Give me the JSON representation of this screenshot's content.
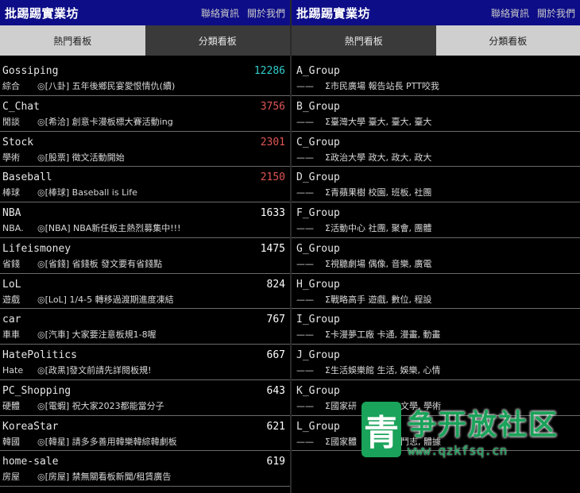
{
  "left": {
    "title": "批踢踢實業坊",
    "links": [
      "聯絡資訊",
      "關於我們"
    ],
    "tabs": [
      {
        "label": "熱門看板"
      },
      {
        "label": "分類看板"
      }
    ],
    "boards": [
      {
        "name": "Gossiping",
        "count": "12286",
        "color": "#33cccc",
        "category": "綜合",
        "desc": "◎[八卦] 五年後鄉民宴愛恨情仇(續)"
      },
      {
        "name": "C_Chat",
        "count": "3756",
        "color": "#e05555",
        "category": "閒談",
        "desc": "◎[希洽] 創意卡漫板標大賽活動ing"
      },
      {
        "name": "Stock",
        "count": "2301",
        "color": "#e05555",
        "category": "學術",
        "desc": "◎[股票] 徵文活動開始"
      },
      {
        "name": "Baseball",
        "count": "2150",
        "color": "#e05555",
        "category": "棒球",
        "desc": "◎[棒球] Baseball is Life"
      },
      {
        "name": "NBA",
        "count": "1633",
        "color": "#ffffff",
        "category": "NBA.",
        "desc": "◎[NBA] NBA新任板主熱烈募集中!!!"
      },
      {
        "name": "Lifeismoney",
        "count": "1475",
        "color": "#ffffff",
        "category": "省錢",
        "desc": "◎[省錢] 省錢板 發文要有省錢點"
      },
      {
        "name": "LoL",
        "count": "824",
        "color": "#ffffff",
        "category": "遊戲",
        "desc": "◎[LoL] 1/4-5 轉移過渡期進度凍結"
      },
      {
        "name": "car",
        "count": "767",
        "color": "#ffffff",
        "category": "車車",
        "desc": "◎[汽車] 大家要注意板規1-8喔"
      },
      {
        "name": "HatePolitics",
        "count": "667",
        "color": "#ffffff",
        "category": "Hate",
        "desc": "◎[政黑]發文前請先詳閱板規!"
      },
      {
        "name": "PC_Shopping",
        "count": "643",
        "color": "#ffffff",
        "category": "硬體",
        "desc": "◎[電蝦] 祝大家2023都能當分子"
      },
      {
        "name": "KoreaStar",
        "count": "621",
        "color": "#ffffff",
        "category": "韓國",
        "desc": "◎[韓星] 請多多善用韓樂韓綜韓劇板"
      },
      {
        "name": "home-sale",
        "count": "619",
        "color": "#ffffff",
        "category": "房屋",
        "desc": "◎[房屋] 禁無關看板新聞/租賃廣告"
      }
    ]
  },
  "right": {
    "title": "批踢踢實業坊",
    "links": [
      "聯絡資訊",
      "關於我們"
    ],
    "tabs": [
      {
        "label": "熱門看板"
      },
      {
        "label": "分類看板"
      }
    ],
    "groups": [
      {
        "name": "A_Group",
        "dash": "——",
        "desc": "Σ市民廣場 報告站長 PTT咬我"
      },
      {
        "name": "B_Group",
        "dash": "——",
        "desc": "Σ臺灣大學 臺大, 臺大, 臺大"
      },
      {
        "name": "C_Group",
        "dash": "——",
        "desc": "Σ政治大學 政大, 政大, 政大"
      },
      {
        "name": "D_Group",
        "dash": "——",
        "desc": "Σ青蘋果樹 校園, 班板, 社團"
      },
      {
        "name": "F_Group",
        "dash": "——",
        "desc": "Σ活動中心 社團, 聚會, 團體"
      },
      {
        "name": "G_Group",
        "dash": "——",
        "desc": "Σ視聽劇場 偶像, 音樂, 廣電"
      },
      {
        "name": "H_Group",
        "dash": "——",
        "desc": "Σ戰略高手 遊戲, 數位, 程設"
      },
      {
        "name": "I_Group",
        "dash": "——",
        "desc": "Σ卡漫夢工廠 卡通, 漫畫, 動畫"
      },
      {
        "name": "J_Group",
        "dash": "——",
        "desc": "Σ生活娛樂館 生活, 娛樂, 心情"
      },
      {
        "name": "K_Group",
        "dash": "——",
        "desc": "Σ國家研　　　　　文學, 學術"
      },
      {
        "name": "L_Group",
        "dash": "——",
        "desc": "Σ國家體　　　　　鬥志, 體據"
      }
    ]
  },
  "watermark": {
    "logo_char": "青",
    "text": "争开放社区",
    "url": "www.qzkfsq.cn"
  }
}
